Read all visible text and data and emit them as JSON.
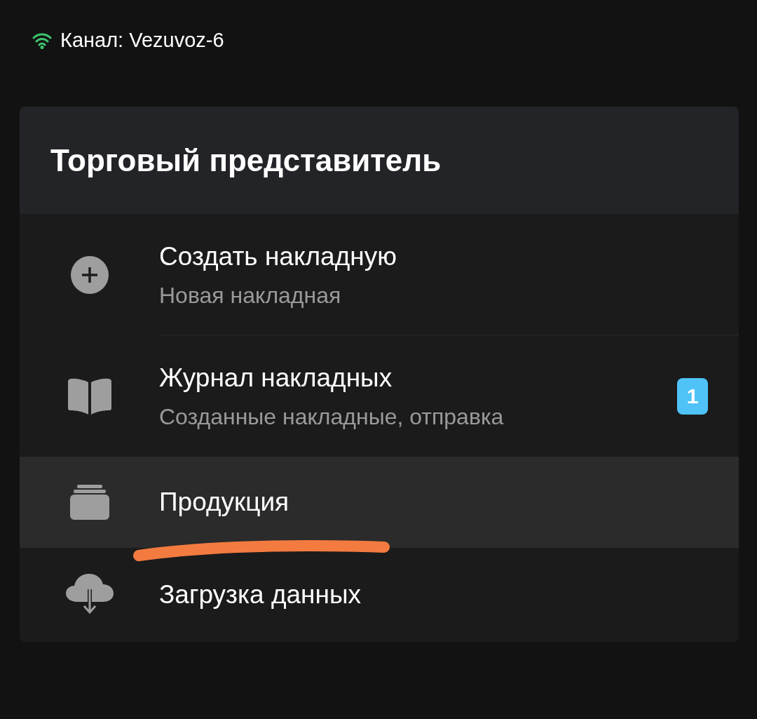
{
  "status": {
    "channel": "Канал: Vezuvoz-6"
  },
  "panel": {
    "title": "Торговый представитель",
    "items": [
      {
        "title": "Создать накладную",
        "subtitle": "Новая накладная",
        "selected": false
      },
      {
        "title": "Журнал накладных",
        "subtitle": "Созданные накладные, отправка",
        "badge": "1",
        "selected": false
      },
      {
        "title": "Продукция",
        "selected": true
      },
      {
        "title": "Загрузка данных",
        "selected": false
      }
    ]
  }
}
